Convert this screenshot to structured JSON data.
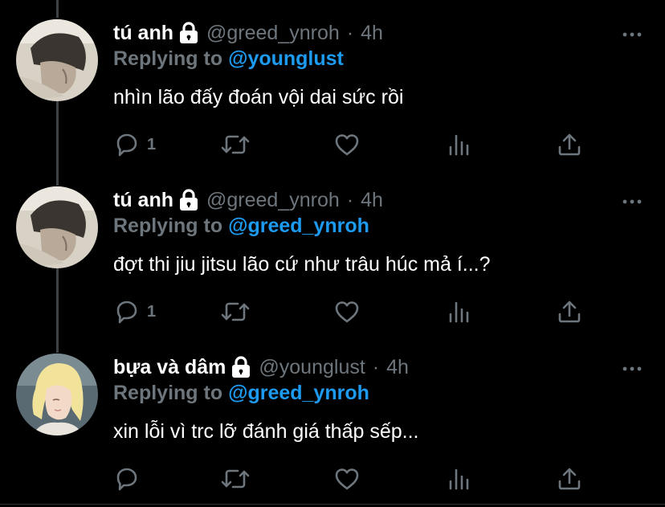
{
  "tweets": [
    {
      "display_name": "tú anh",
      "handle": "@greed_ynroh",
      "separator": "·",
      "time": "4h",
      "reply_prefix": "Replying to",
      "reply_target": "@younglust",
      "text": "nhìn lão đấy đoán vội dai sức rồi",
      "reply_count": "1",
      "icons": [
        "lock-icon",
        "more-icon",
        "reply-icon",
        "retweet-icon",
        "like-icon",
        "analytics-icon",
        "share-icon"
      ]
    },
    {
      "display_name": "tú anh",
      "handle": "@greed_ynroh",
      "separator": "·",
      "time": "4h",
      "reply_prefix": "Replying to",
      "reply_target": "@greed_ynroh",
      "text": "đợt thi jiu jitsu lão cứ như trâu húc mả í...?",
      "reply_count": "1",
      "icons": [
        "lock-icon",
        "more-icon",
        "reply-icon",
        "retweet-icon",
        "like-icon",
        "analytics-icon",
        "share-icon"
      ]
    },
    {
      "display_name": "bựa và dâm",
      "handle": "@younglust",
      "separator": "·",
      "time": "4h",
      "reply_prefix": "Replying to",
      "reply_target": "@greed_ynroh",
      "text": "xin lỗi vì trc lỡ đánh giá thấp sếp...",
      "reply_count": "",
      "icons": [
        "lock-icon",
        "more-icon",
        "reply-icon",
        "retweet-icon",
        "like-icon",
        "analytics-icon",
        "share-icon"
      ]
    }
  ],
  "colors": {
    "background": "#000000",
    "text_primary": "#ffffff",
    "text_secondary": "#6e767d",
    "link": "#1d9bf0",
    "thread_line": "#3d4247"
  }
}
